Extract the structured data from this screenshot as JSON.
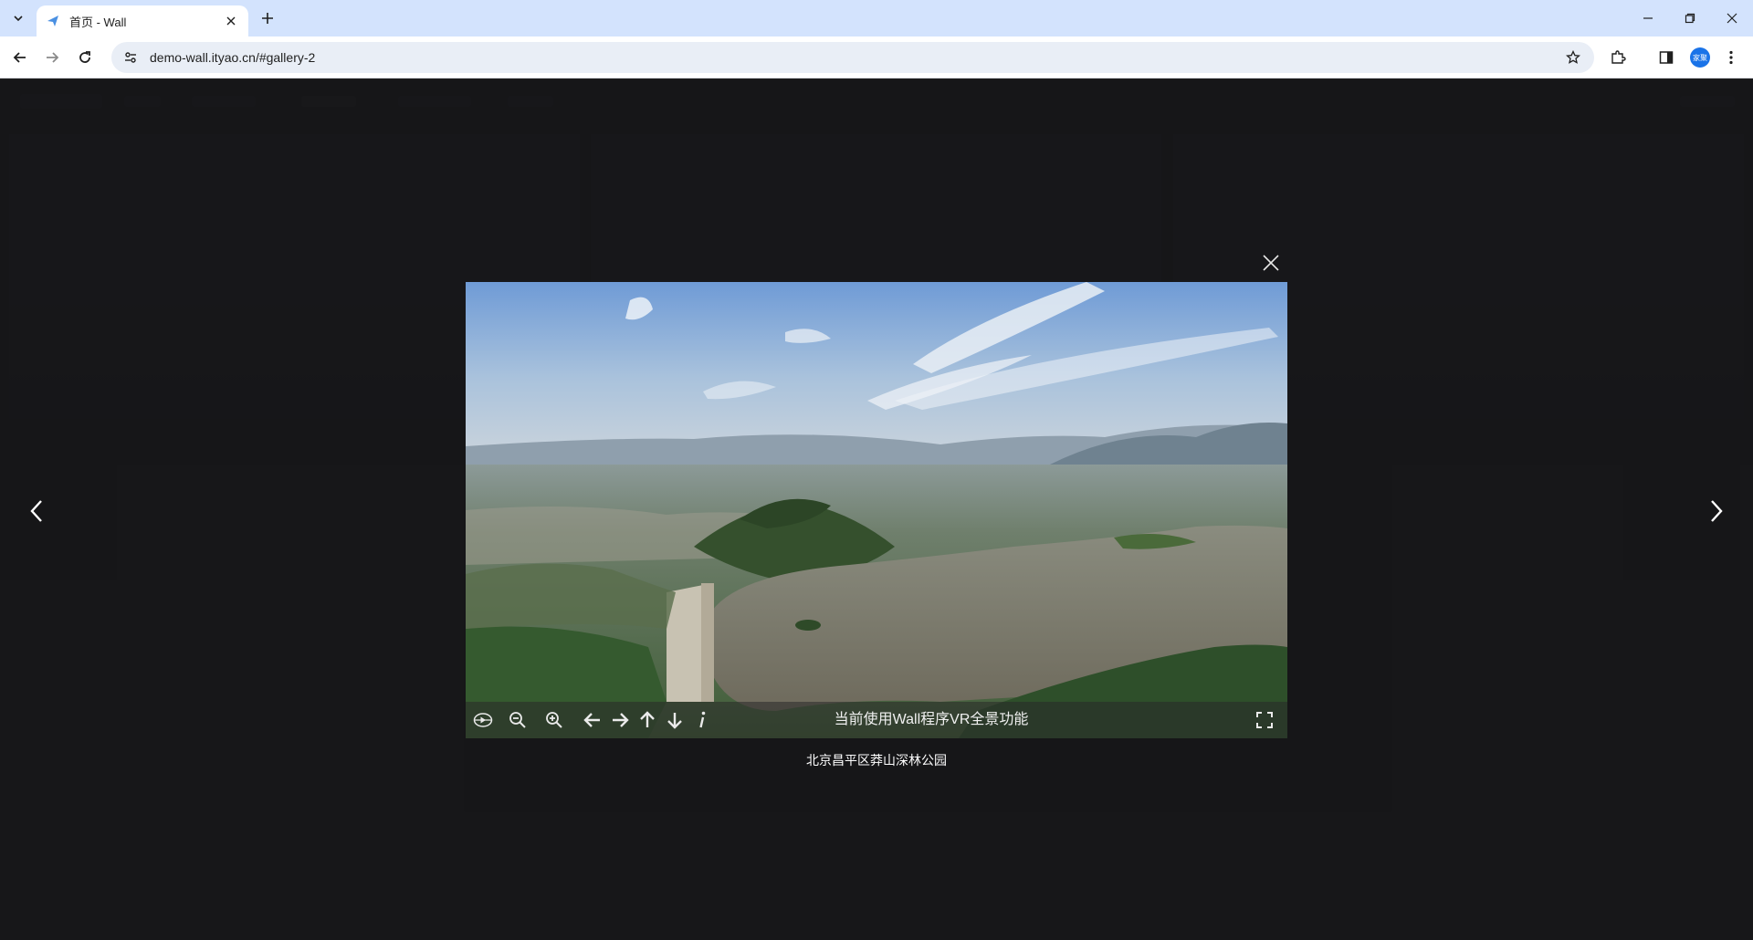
{
  "browser": {
    "tab": {
      "title": "首页 - Wall"
    },
    "address": {
      "url": "demo-wall.ityao.cn/#gallery-2"
    },
    "profile_badge": "家聚"
  },
  "colors": {
    "chrome_tabstrip": "#d3e3fd",
    "page_background": "#1e1e20",
    "viewer_bar": "#282828",
    "profile_badge": "#1a73e8"
  },
  "lightbox": {
    "vr_caption": "当前使用Wall程序VR全景功能",
    "photo_caption": "北京昌平区莽山深林公园",
    "controls": [
      "autorotate-icon",
      "zoom-out-icon",
      "zoom-in-icon",
      "arrow-left-icon",
      "arrow-right-icon",
      "arrow-up-icon",
      "arrow-down-icon",
      "info-icon",
      "fullscreen-icon"
    ]
  }
}
